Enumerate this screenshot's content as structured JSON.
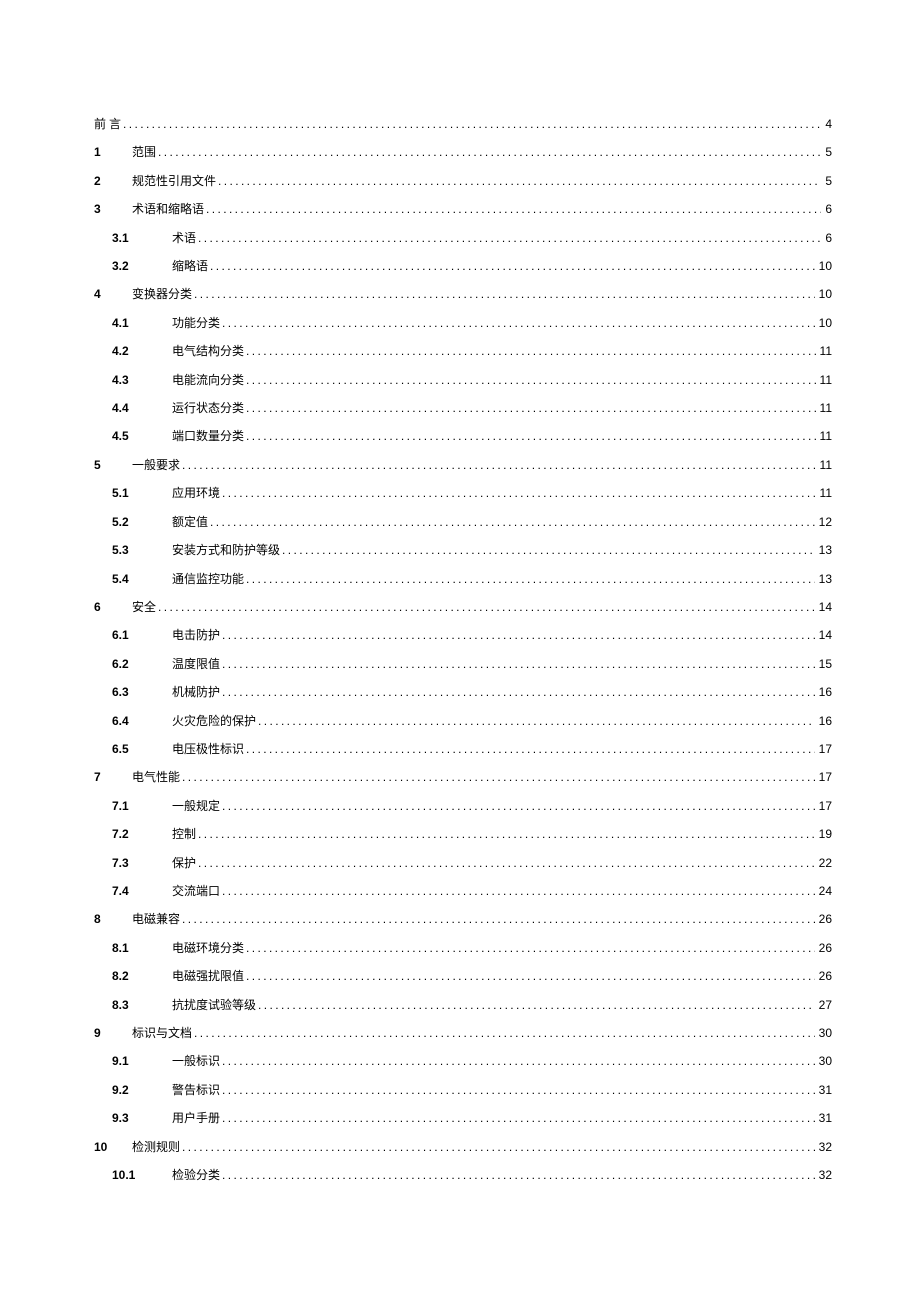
{
  "toc": [
    {
      "level": 0,
      "num": "",
      "title": "前 言",
      "page": "4"
    },
    {
      "level": 1,
      "num": "1",
      "title": "范围",
      "page": "5"
    },
    {
      "level": 1,
      "num": "2",
      "title": "规范性引用文件",
      "page": "5"
    },
    {
      "level": 1,
      "num": "3",
      "title": "术语和缩略语",
      "page": "6"
    },
    {
      "level": 2,
      "num": "3.1",
      "title": "术语",
      "page": "6"
    },
    {
      "level": 2,
      "num": "3.2",
      "title": "缩略语",
      "page": "10"
    },
    {
      "level": 1,
      "num": "4",
      "title": "变换器分类",
      "page": "10"
    },
    {
      "level": 2,
      "num": "4.1",
      "title": "功能分类",
      "page": "10"
    },
    {
      "level": 2,
      "num": "4.2",
      "title": "电气结构分类",
      "page": "11"
    },
    {
      "level": 2,
      "num": "4.3",
      "title": "电能流向分类",
      "page": "11"
    },
    {
      "level": 2,
      "num": "4.4",
      "title": "运行状态分类",
      "page": "11"
    },
    {
      "level": 2,
      "num": "4.5",
      "title": "端口数量分类",
      "page": "11"
    },
    {
      "level": 1,
      "num": "5",
      "title": "一般要求",
      "page": "11"
    },
    {
      "level": 2,
      "num": "5.1",
      "title": "应用环境",
      "page": "11"
    },
    {
      "level": 2,
      "num": "5.2",
      "title": "额定值",
      "page": "12"
    },
    {
      "level": 2,
      "num": "5.3",
      "title": "安装方式和防护等级",
      "page": "13"
    },
    {
      "level": 2,
      "num": "5.4",
      "title": "通信监控功能",
      "page": "13"
    },
    {
      "level": 1,
      "num": "6",
      "title": "安全",
      "page": "14"
    },
    {
      "level": 2,
      "num": "6.1",
      "title": "电击防护",
      "page": "14"
    },
    {
      "level": 2,
      "num": "6.2",
      "title": "温度限值",
      "page": "15"
    },
    {
      "level": 2,
      "num": "6.3",
      "title": "机械防护",
      "page": "16"
    },
    {
      "level": 2,
      "num": "6.4",
      "title": "火灾危险的保护",
      "page": "16"
    },
    {
      "level": 2,
      "num": "6.5",
      "title": "电压极性标识",
      "page": "17"
    },
    {
      "level": 1,
      "num": "7",
      "title": "电气性能",
      "page": "17"
    },
    {
      "level": 2,
      "num": "7.1",
      "title": "一般规定",
      "page": "17"
    },
    {
      "level": 2,
      "num": "7.2",
      "title": "控制",
      "page": "19"
    },
    {
      "level": 2,
      "num": "7.3",
      "title": "保护",
      "page": "22"
    },
    {
      "level": 2,
      "num": "7.4",
      "title": "交流端口",
      "page": "24"
    },
    {
      "level": 1,
      "num": "8",
      "title": "电磁兼容",
      "page": "26"
    },
    {
      "level": 2,
      "num": "8.1",
      "title": "电磁环境分类",
      "page": "26"
    },
    {
      "level": 2,
      "num": "8.2",
      "title": "电磁强扰限值",
      "page": "26"
    },
    {
      "level": 2,
      "num": "8.3",
      "title": "抗扰度试验等级",
      "page": "27"
    },
    {
      "level": 1,
      "num": "9",
      "title": "标识与文档",
      "page": "30"
    },
    {
      "level": 2,
      "num": "9.1",
      "title": "一般标识",
      "page": "30"
    },
    {
      "level": 2,
      "num": "9.2",
      "title": "警告标识",
      "page": "31"
    },
    {
      "level": 2,
      "num": "9.3",
      "title": "用户手册",
      "page": "31"
    },
    {
      "level": 1,
      "num": "10",
      "title": "检测规则",
      "page": "32"
    },
    {
      "level": 3,
      "num": "10.1",
      "title": "检验分类",
      "page": "32"
    }
  ]
}
